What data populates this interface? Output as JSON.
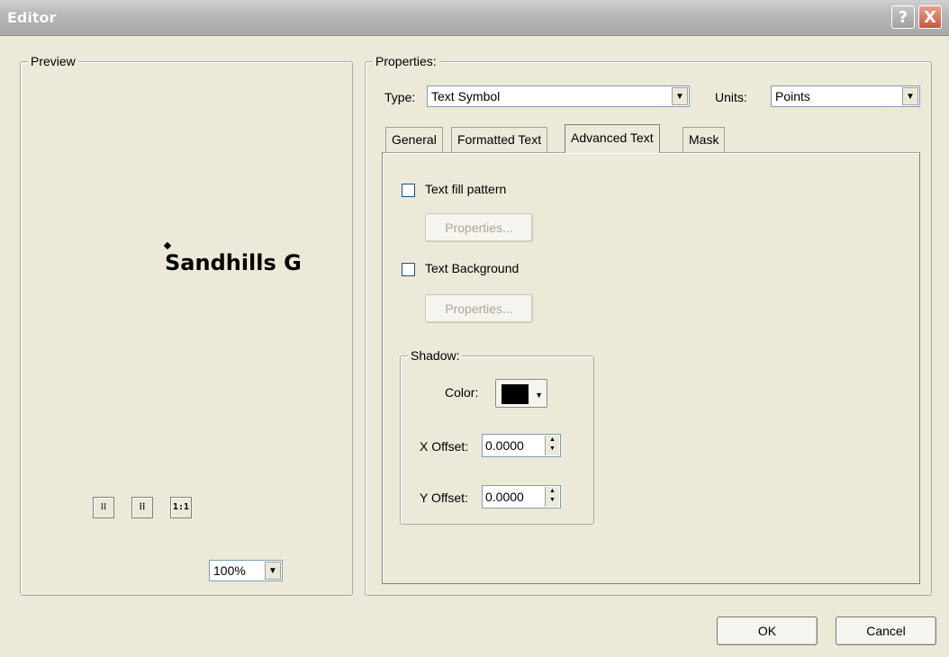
{
  "window": {
    "title": "Editor",
    "help_icon": "?",
    "close_icon": "X"
  },
  "preview": {
    "legend": "Preview",
    "sample_text": "Sandhills G",
    "zoom_buttons": [
      {
        "name": "zoom-in-fixed-icon",
        "glyph": "⁝⁝"
      },
      {
        "name": "zoom-out-fixed-icon",
        "glyph": "⁞⁞"
      },
      {
        "name": "zoom-actual-size-icon",
        "glyph": "1:1"
      }
    ],
    "zoom_value": "100%"
  },
  "properties": {
    "legend": "Properties:",
    "type_label": "Type:",
    "type_value": "Text Symbol",
    "units_label": "Units:",
    "units_value": "Points",
    "tabs": [
      {
        "label": "General",
        "active": false
      },
      {
        "label": "Formatted Text",
        "active": false
      },
      {
        "label": "Advanced Text",
        "active": true
      },
      {
        "label": "Mask",
        "active": false
      }
    ],
    "advanced": {
      "text_fill_pattern_label": "Text fill pattern",
      "text_fill_pattern_checked": false,
      "fill_properties_label": "Properties...",
      "text_background_label": "Text Background",
      "text_background_checked": false,
      "background_properties_label": "Properties...",
      "shadow": {
        "legend": "Shadow:",
        "color_label": "Color:",
        "color_value": "#000000",
        "x_offset_label": "X Offset:",
        "x_offset_value": "0.0000",
        "y_offset_label": "Y Offset:",
        "y_offset_value": "0.0000"
      }
    }
  },
  "footer": {
    "ok_label": "OK",
    "cancel_label": "Cancel"
  }
}
